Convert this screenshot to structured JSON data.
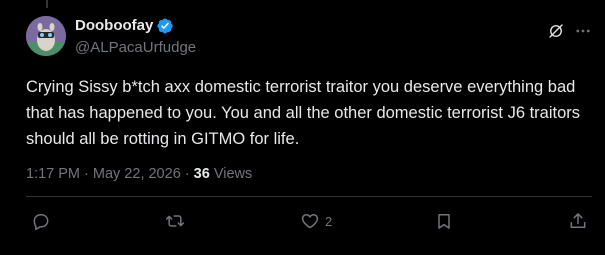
{
  "author": {
    "display_name": "Dooboofay",
    "handle": "@ALPacaUrfudge",
    "verified": true
  },
  "tweet": {
    "text": "Crying Sissy b*tch axx domestic terrorist traitor you deserve everything bad that has happened to you. You and all the other domestic terrorist J6 traitors should all be rotting in GITMO for life."
  },
  "meta": {
    "time": "1:17 PM",
    "separator": " · ",
    "date": "May 22, 2026",
    "views_count": "36",
    "views_label": "Views"
  },
  "actions": {
    "reply_count": "",
    "repost_count": "",
    "like_count": "2",
    "bookmark_count": ""
  },
  "icons": {
    "verified": "verified-badge-icon",
    "grok": "grok-icon",
    "more": "more-dots-icon",
    "reply": "reply-bubble-icon",
    "repost": "repost-arrows-icon",
    "like": "heart-icon",
    "bookmark": "bookmark-icon",
    "share": "share-upload-icon"
  },
  "colors": {
    "background": "#000000",
    "text_primary": "#e7e9ea",
    "text_secondary": "#71767b",
    "verified_blue": "#1d9bf0",
    "divider": "#2f3336"
  }
}
